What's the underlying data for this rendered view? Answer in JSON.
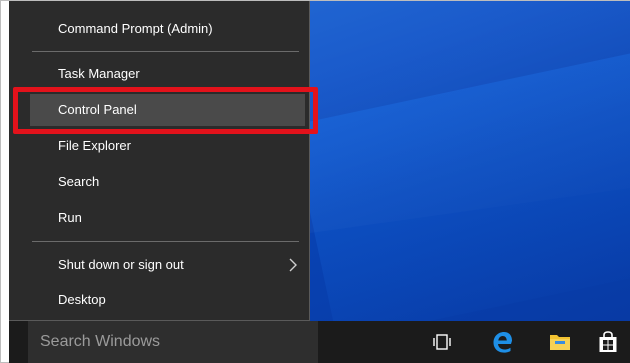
{
  "menu": {
    "items": [
      {
        "label": "Command Prompt (Admin)"
      },
      {
        "label": "Task Manager"
      },
      {
        "label": "Control Panel"
      },
      {
        "label": "File Explorer"
      },
      {
        "label": "Search"
      },
      {
        "label": "Run"
      },
      {
        "label": "Shut down or sign out"
      },
      {
        "label": "Desktop"
      }
    ],
    "hovered_item": "Control Panel",
    "submenu_indicator": "chevron-right-icon"
  },
  "taskbar": {
    "search_label": "Search Windows",
    "icons": [
      "task-view-icon",
      "edge-icon",
      "file-explorer-icon",
      "store-icon"
    ]
  },
  "colors": {
    "menu_background": "#2b2b2b",
    "menu_hover": "#4a4a4a",
    "highlight_border": "#e3121b",
    "desktop_blue": "#0a4fc7",
    "taskbar": "#1b1b1b",
    "edge_blue": "#1e8fe6",
    "explorer_yellow": "#f2c230"
  }
}
